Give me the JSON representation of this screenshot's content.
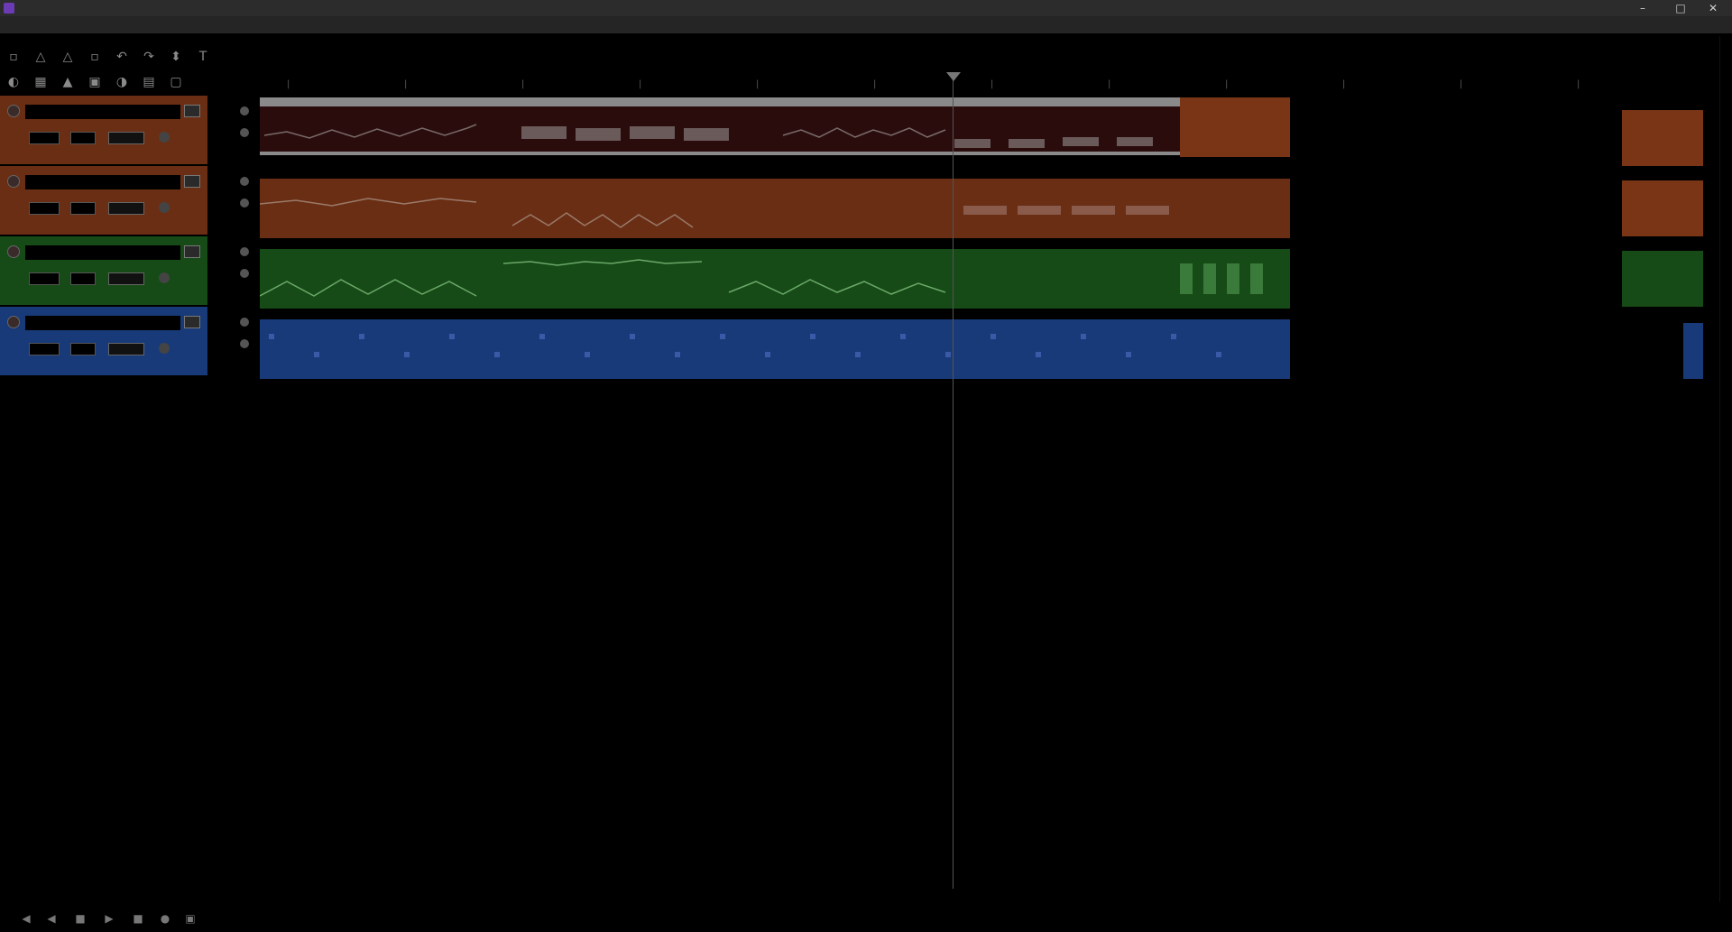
{
  "window": {
    "title": "",
    "controls": [
      "–",
      "□",
      "✕"
    ]
  },
  "menubar": {
    "items": [
      "",
      "",
      "",
      "",
      "",
      "",
      "",
      "",
      "",
      "",
      "",
      "",
      "",
      ""
    ],
    "right_status": ""
  },
  "marker": {
    "label": ""
  },
  "tracks": [
    {
      "name": "",
      "color": "#6a2e14"
    },
    {
      "name": "",
      "color": "#6a2e14"
    },
    {
      "name": "",
      "color": "#164a16"
    },
    {
      "name": "",
      "color": "#183a78"
    }
  ],
  "transport": {
    "time_position": "",
    "time_length": "",
    "status": ""
  },
  "statusbar": {
    "items": [
      "",
      "",
      "",
      "",
      "",
      "",
      ""
    ]
  }
}
